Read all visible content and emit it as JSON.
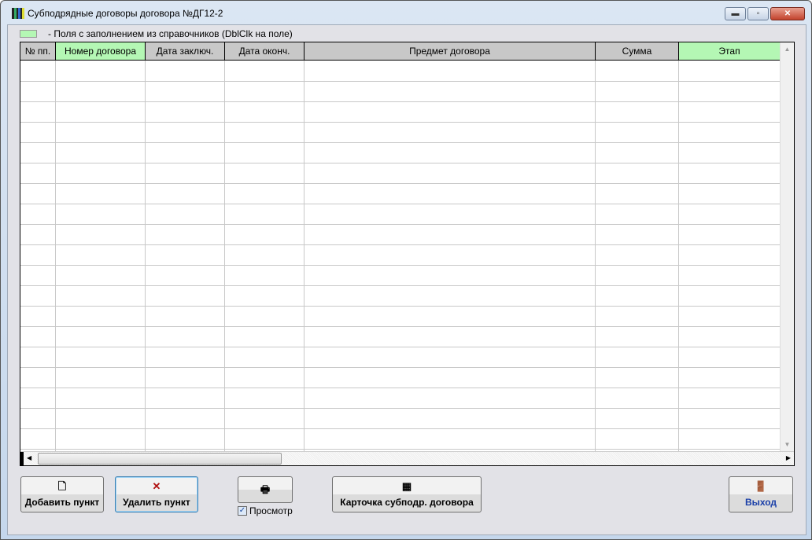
{
  "window": {
    "title": "Субподрядные договоры договора №ДГ12-2"
  },
  "legend": {
    "text": "-  Поля с заполнением из справочников (DblClk на поле)",
    "color": "#b4f7b4"
  },
  "table": {
    "columns": [
      "№ пп.",
      "Номер договора",
      "Дата заключ.",
      "Дата оконч.",
      "Предмет договора",
      "Сумма",
      "Этап"
    ],
    "rows": []
  },
  "buttons": {
    "add": "Добавить пункт",
    "delete": "Удалить пункт",
    "card": "Карточка субподр. договора",
    "exit": "Выход",
    "preview": "Просмотр"
  }
}
